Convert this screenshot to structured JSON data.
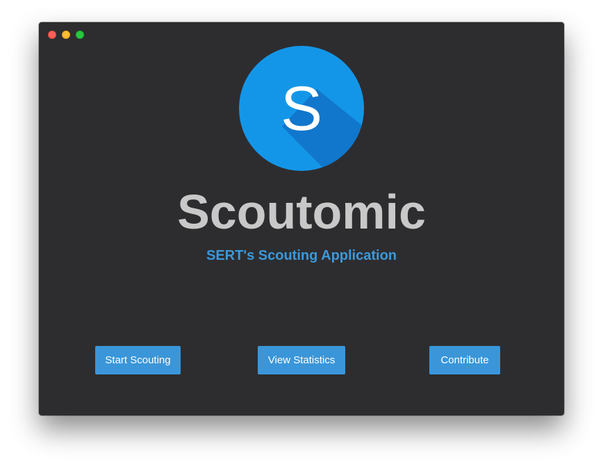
{
  "window": {
    "controls": {
      "close_icon": "close-icon",
      "minimize_icon": "minimize-icon",
      "maximize_icon": "maximize-icon"
    }
  },
  "logo": {
    "letter": "S",
    "icon": "app-logo-icon",
    "circle_color": "#1496e8",
    "shadow_color": "#1177cc"
  },
  "app": {
    "title": "Scoutomic",
    "subtitle": "SERT's Scouting Application"
  },
  "actions": {
    "start_label": "Start Scouting",
    "stats_label": "View Statistics",
    "contribute_label": "Contribute"
  },
  "colors": {
    "accent": "#3a96d9",
    "window_bg": "#2d2d30",
    "title_text": "#c8c8c8"
  }
}
